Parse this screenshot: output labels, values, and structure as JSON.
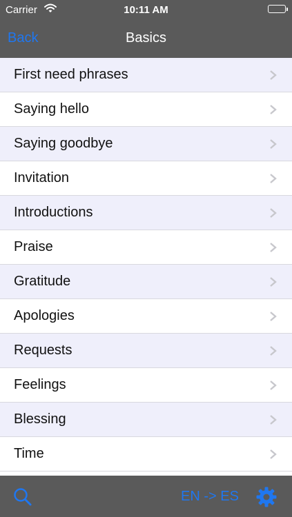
{
  "status_bar": {
    "carrier": "Carrier",
    "time": "10:11 AM",
    "icons": [
      "wifi-icon",
      "battery-icon"
    ]
  },
  "nav_bar": {
    "back_label": "Back",
    "title": "Basics"
  },
  "list": {
    "items": [
      {
        "label": "First need phrases"
      },
      {
        "label": "Saying hello"
      },
      {
        "label": "Saying goodbye"
      },
      {
        "label": "Invitation"
      },
      {
        "label": "Introductions"
      },
      {
        "label": "Praise"
      },
      {
        "label": "Gratitude"
      },
      {
        "label": "Apologies"
      },
      {
        "label": "Requests"
      },
      {
        "label": "Feelings"
      },
      {
        "label": "Blessing"
      },
      {
        "label": "Time"
      }
    ]
  },
  "toolbar": {
    "language_label": "EN -> ES",
    "icons": [
      "search-icon",
      "gear-icon"
    ]
  },
  "colors": {
    "bar_background": "#5a5a5a",
    "accent": "#1f77f0",
    "alt_row": "#efeffb",
    "row": "#ffffff",
    "separator": "#d8d8de"
  }
}
